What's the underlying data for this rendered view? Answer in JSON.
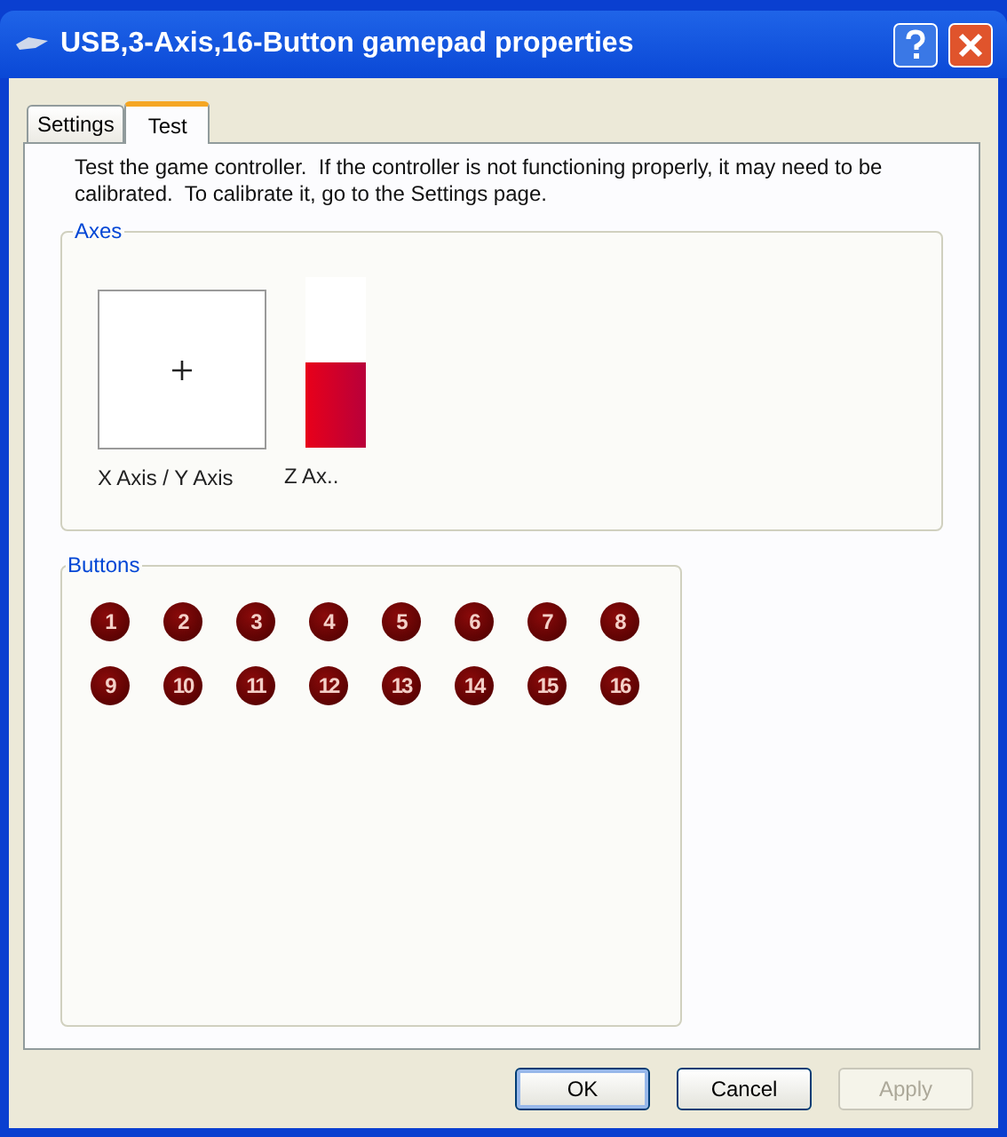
{
  "window": {
    "title": "USB,3-Axis,16-Button gamepad properties"
  },
  "tabs": [
    {
      "label": "Settings",
      "selected": false
    },
    {
      "label": "Test",
      "selected": true
    }
  ],
  "description": "Test the game controller.  If the controller is not functioning properly, it may need to be calibrated.  To calibrate it, go to the Settings page.",
  "axes": {
    "title": "Axes",
    "xy_label": "X Axis / Y Axis",
    "z_axis": {
      "label": "Z Ax..",
      "level": 0.5
    }
  },
  "buttons_group": {
    "title": "Buttons",
    "buttons": [
      {
        "label": "1",
        "pressed": false
      },
      {
        "label": "2",
        "pressed": false
      },
      {
        "label": "3",
        "pressed": false
      },
      {
        "label": "4",
        "pressed": false
      },
      {
        "label": "5",
        "pressed": false
      },
      {
        "label": "6",
        "pressed": false
      },
      {
        "label": "7",
        "pressed": false
      },
      {
        "label": "8",
        "pressed": false
      },
      {
        "label": "9",
        "pressed": false
      },
      {
        "label": "10",
        "pressed": false
      },
      {
        "label": "11",
        "pressed": false
      },
      {
        "label": "12",
        "pressed": false
      },
      {
        "label": "13",
        "pressed": false
      },
      {
        "label": "14",
        "pressed": false
      },
      {
        "label": "15",
        "pressed": false
      },
      {
        "label": "16",
        "pressed": false
      }
    ]
  },
  "dialog_buttons": [
    {
      "label": "OK",
      "default": true,
      "disabled": false
    },
    {
      "label": "Cancel",
      "default": false,
      "disabled": false
    },
    {
      "label": "Apply",
      "default": false,
      "disabled": true
    }
  ]
}
